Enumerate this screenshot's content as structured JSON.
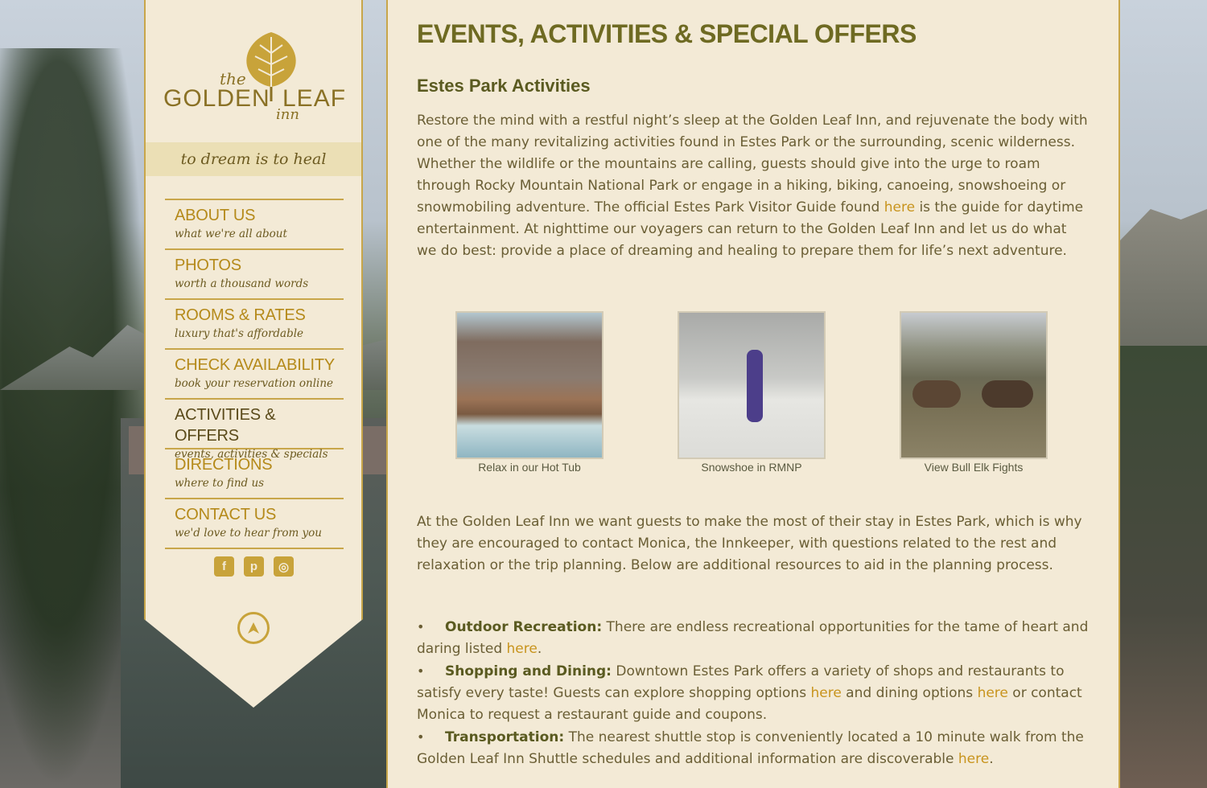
{
  "sidebar": {
    "logo": {
      "the": "the",
      "golden": "GOLDEN",
      "leaf": "LEAF",
      "inn": "inn"
    },
    "tagline": "to dream is to heal",
    "nav": [
      {
        "title": "ABOUT US",
        "subtitle": "what we're all about"
      },
      {
        "title": "PHOTOS",
        "subtitle": "worth a thousand words"
      },
      {
        "title": "ROOMS & RATES",
        "subtitle": "luxury that's affordable"
      },
      {
        "title": "CHECK AVAILABILITY",
        "subtitle": "book your reservation online"
      },
      {
        "title": "ACTIVITIES & OFFERS",
        "subtitle": "events, activities & specials"
      },
      {
        "title": "DIRECTIONS",
        "subtitle": "where to find us"
      },
      {
        "title": "CONTACT US",
        "subtitle": "we'd love to hear from you"
      }
    ],
    "social": {
      "facebook": "f",
      "pinterest": "p",
      "instagram": "◎"
    }
  },
  "main": {
    "page_title": "EVENTS, ACTIVITIES & SPECIAL OFFERS",
    "section_title": "Estes Park Activities",
    "p1": {
      "before": "Restore the mind with a restful night’s sleep at the Golden Leaf Inn, and rejuvenate the body with one of the many revitalizing activities found in Estes Park or the surrounding, scenic wilderness. Whether the wildlife or the mountains are calling, guests should give into the urge to roam through Rocky Mountain National Park or engage in a hiking, biking, canoeing, snowshoeing or snowmobiling adventure. The official Estes Park Visitor Guide found ",
      "link": "here",
      "after": " is the guide for daytime entertainment. At nighttime our voyagers can return to the Golden Leaf Inn and let us do what we do best: provide a place of dreaming and healing to prepare them for life’s next adventure."
    },
    "gallery": [
      {
        "caption": "Relax in our Hot Tub"
      },
      {
        "caption": "Snowshoe in RMNP"
      },
      {
        "caption": "View Bull Elk Fights"
      }
    ],
    "p2": "At the Golden Leaf Inn we want guests to make the most of their stay in Estes Park, which is why they are encouraged to contact Monica, the Innkeeper, with questions related to the rest and relaxation or the trip planning. Below are additional resources to aid in the planning process.",
    "bullets": [
      {
        "label": "Outdoor Recreation:",
        "text": " There are endless recreational opportunities for the tame of heart and daring listed ",
        "link": "here",
        "end": "."
      },
      {
        "label": "Shopping and Dining:",
        "text": " Downtown Estes Park offers a variety of shops and restaurants to satisfy every taste! Guests can explore shopping options ",
        "link": "here",
        "mid": " and dining options ",
        "link2": "here",
        "end": " or contact Monica to request a restaurant guide and coupons."
      },
      {
        "label": "Transportation:",
        "text": " The nearest shuttle stop is conveniently located a 10 minute walk from the Golden Leaf Inn Shuttle schedules and additional information are discoverable ",
        "link": "here",
        "end": "."
      }
    ]
  },
  "colors": {
    "gold": "#c8a33a",
    "panel": "#f3ead6",
    "olive": "#6e6a22",
    "link": "#c8941d"
  }
}
